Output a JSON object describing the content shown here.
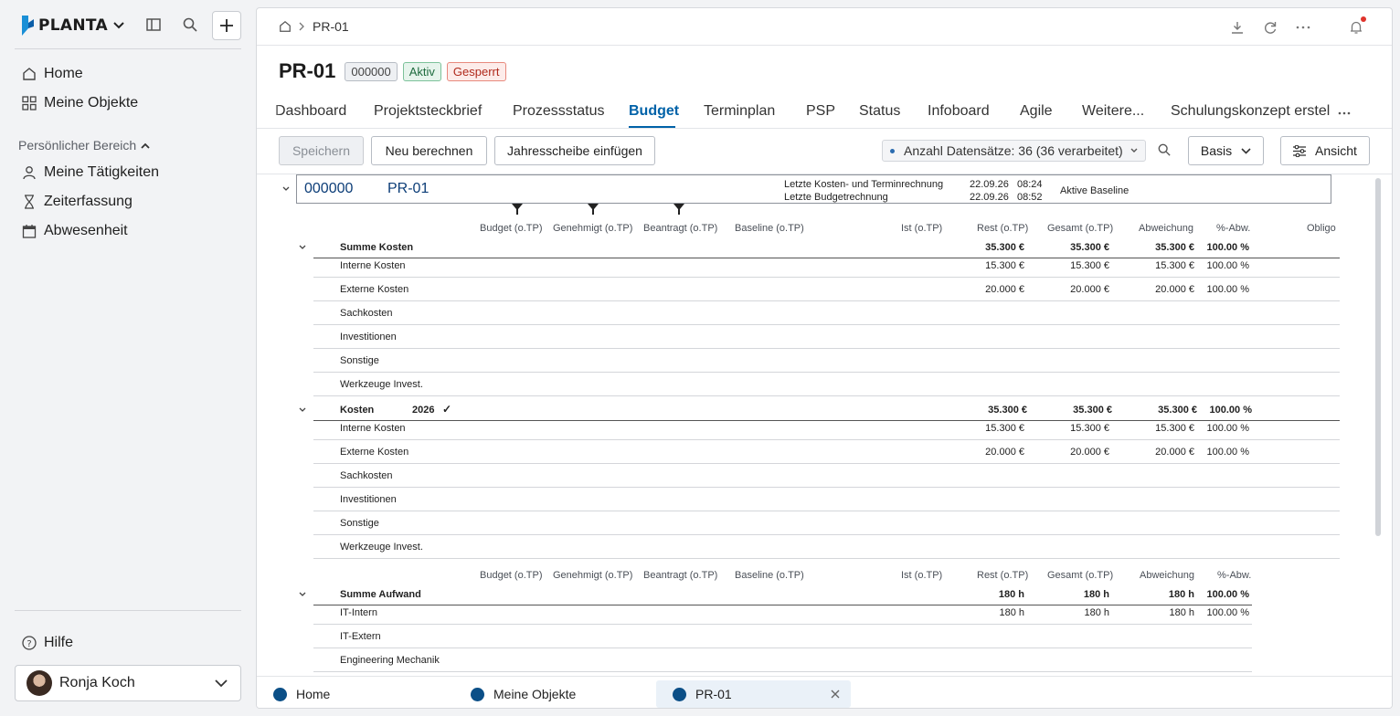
{
  "app": {
    "brand": "PLANTA",
    "accent": "#0062a8"
  },
  "sidebar": {
    "nav": [
      {
        "label": "Home",
        "icon": "home-icon"
      },
      {
        "label": "Meine Objekte",
        "icon": "grid-icon"
      }
    ],
    "section_label": "Persönlicher Bereich",
    "personal": [
      {
        "label": "Meine Tätigkeiten",
        "icon": "person-icon"
      },
      {
        "label": "Zeiterfassung",
        "icon": "hourglass-icon"
      },
      {
        "label": "Abwesenheit",
        "icon": "calendar-icon"
      }
    ],
    "help_label": "Hilfe",
    "user_name": "Ronja Koch"
  },
  "breadcrumb": {
    "current": "PR-01"
  },
  "header": {
    "title": "PR-01",
    "badges": {
      "id": "000000",
      "status": "Aktiv",
      "locked": "Gesperrt"
    }
  },
  "tabs": [
    "Dashboard",
    "Projektsteckbrief",
    "Prozessstatus",
    "Budget",
    "Terminplan",
    "PSP",
    "Status",
    "Infoboard",
    "Agile",
    "Weitere...",
    "Schulungskonzept erstel"
  ],
  "active_tab": "Budget",
  "toolbar": {
    "save": "Speichern",
    "recalc": "Neu berechnen",
    "insert_year": "Jahresscheibe einfügen",
    "datasets": "Anzahl Datensätze: 36 (36 verarbeitet)",
    "view_select": "Basis",
    "view_button": "Ansicht"
  },
  "project_box": {
    "id": "000000",
    "name": "PR-01",
    "calc1_label": "Letzte Kosten- und Terminrechnung",
    "calc1_date": "22.09.26",
    "calc1_time": "08:24",
    "calc2_label": "Letzte Budgetrechnung",
    "calc2_date": "22.09.26",
    "calc2_time": "08:52",
    "baseline_label": "Aktive Baseline"
  },
  "columns": [
    "Budget (o.TP)",
    "Genehmigt (o.TP)",
    "Beantragt (o.TP)",
    "Baseline (o.TP)",
    "Ist (o.TP)",
    "Rest (o.TP)",
    "Gesamt (o.TP)",
    "Abweichung",
    "%-Abw.",
    "Obligo"
  ],
  "sum_costs": {
    "label": "Summe Kosten",
    "rest": "35.300 €",
    "gesamt": "35.300 €",
    "abw": "35.300 €",
    "pct": "100.00 %",
    "rows": [
      {
        "label": "Interne Kosten",
        "rest": "15.300 €",
        "gesamt": "15.300 €",
        "abw": "15.300 €",
        "pct": "100.00 %"
      },
      {
        "label": "Externe Kosten",
        "rest": "20.000 €",
        "gesamt": "20.000 €",
        "abw": "20.000 €",
        "pct": "100.00 %"
      },
      {
        "label": "Sachkosten",
        "rest": "",
        "gesamt": "",
        "abw": "",
        "pct": ""
      },
      {
        "label": "Investitionen",
        "rest": "",
        "gesamt": "",
        "abw": "",
        "pct": ""
      },
      {
        "label": "Sonstige",
        "rest": "",
        "gesamt": "",
        "abw": "",
        "pct": ""
      },
      {
        "label": "Werkzeuge Invest.",
        "rest": "",
        "gesamt": "",
        "abw": "",
        "pct": ""
      }
    ]
  },
  "costs_2026": {
    "label": "Kosten",
    "year": "2026",
    "check": "✓",
    "rest": "35.300 €",
    "gesamt": "35.300 €",
    "abw": "35.300 €",
    "pct": "100.00 %",
    "rows": [
      {
        "label": "Interne Kosten",
        "rest": "15.300 €",
        "gesamt": "15.300 €",
        "abw": "15.300 €",
        "pct": "100.00 %"
      },
      {
        "label": "Externe Kosten",
        "rest": "20.000 €",
        "gesamt": "20.000 €",
        "abw": "20.000 €",
        "pct": "100.00 %"
      },
      {
        "label": "Sachkosten",
        "rest": "",
        "gesamt": "",
        "abw": "",
        "pct": ""
      },
      {
        "label": "Investitionen",
        "rest": "",
        "gesamt": "",
        "abw": "",
        "pct": ""
      },
      {
        "label": "Sonstige",
        "rest": "",
        "gesamt": "",
        "abw": "",
        "pct": ""
      },
      {
        "label": "Werkzeuge Invest.",
        "rest": "",
        "gesamt": "",
        "abw": "",
        "pct": ""
      }
    ]
  },
  "effort_columns": [
    "Budget (o.TP)",
    "Genehmigt (o.TP)",
    "Beantragt (o.TP)",
    "Baseline (o.TP)",
    "Ist (o.TP)",
    "Rest (o.TP)",
    "Gesamt (o.TP)",
    "Abweichung",
    "%-Abw."
  ],
  "sum_effort": {
    "label": "Summe Aufwand",
    "rest": "180 h",
    "gesamt": "180 h",
    "abw": "180 h",
    "pct": "100.00 %",
    "rows": [
      {
        "label": "IT-Intern",
        "rest": "180 h",
        "gesamt": "180 h",
        "abw": "180 h",
        "pct": "100.00 %"
      },
      {
        "label": "IT-Extern",
        "rest": "",
        "gesamt": "",
        "abw": "",
        "pct": ""
      },
      {
        "label": "Engineering Mechanik",
        "rest": "",
        "gesamt": "",
        "abw": "",
        "pct": ""
      }
    ]
  },
  "bottom_tabs": [
    "Home",
    "Meine Objekte",
    "PR-01"
  ],
  "active_bottom_tab": "PR-01"
}
